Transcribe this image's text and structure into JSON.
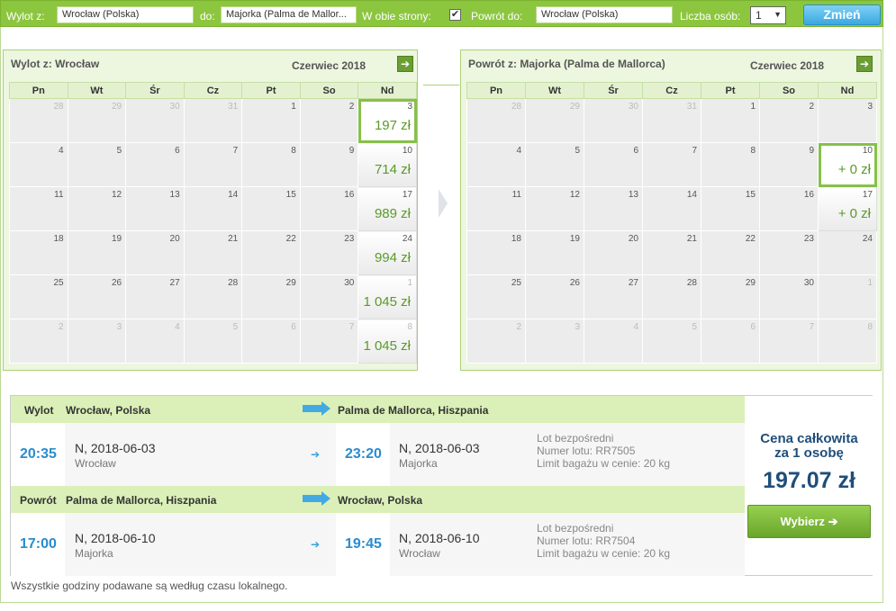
{
  "search": {
    "from_label": "Wylot z:",
    "from_value": "Wrocław (Polska)",
    "to_label": "do:",
    "to_value": "Majorka (Palma de Mallor...",
    "roundtrip_label": "W obie strony:",
    "roundtrip_check": "✔",
    "return_label": "Powrót do:",
    "return_value": "Wrocław (Polska)",
    "persons_label": "Liczba osób:",
    "persons_value": "1",
    "caret": "▼",
    "submit_label": "Zmień"
  },
  "outbound_calendar": {
    "title": "Wylot z: Wrocław",
    "month": "Czerwiec 2018",
    "next_icon": "➔",
    "weekdays": [
      "Pn",
      "Wt",
      "Śr",
      "Cz",
      "Pt",
      "So",
      "Nd"
    ],
    "weeks": [
      [
        {
          "d": "28",
          "m": true
        },
        {
          "d": "29",
          "m": true
        },
        {
          "d": "30",
          "m": true
        },
        {
          "d": "31",
          "m": true
        },
        {
          "d": "1"
        },
        {
          "d": "2"
        },
        {
          "d": "3",
          "p": "197 zł",
          "s": true
        }
      ],
      [
        {
          "d": "4"
        },
        {
          "d": "5"
        },
        {
          "d": "6"
        },
        {
          "d": "7"
        },
        {
          "d": "8"
        },
        {
          "d": "9"
        },
        {
          "d": "10",
          "p": "714 zł"
        }
      ],
      [
        {
          "d": "11"
        },
        {
          "d": "12"
        },
        {
          "d": "13"
        },
        {
          "d": "14"
        },
        {
          "d": "15"
        },
        {
          "d": "16"
        },
        {
          "d": "17",
          "p": "989 zł"
        }
      ],
      [
        {
          "d": "18"
        },
        {
          "d": "19"
        },
        {
          "d": "20"
        },
        {
          "d": "21"
        },
        {
          "d": "22"
        },
        {
          "d": "23"
        },
        {
          "d": "24",
          "p": "994 zł"
        }
      ],
      [
        {
          "d": "25"
        },
        {
          "d": "26"
        },
        {
          "d": "27"
        },
        {
          "d": "28"
        },
        {
          "d": "29"
        },
        {
          "d": "30"
        },
        {
          "d": "1",
          "m": true,
          "p": "1 045 zł"
        }
      ],
      [
        {
          "d": "2",
          "m": true
        },
        {
          "d": "3",
          "m": true
        },
        {
          "d": "4",
          "m": true
        },
        {
          "d": "5",
          "m": true
        },
        {
          "d": "6",
          "m": true
        },
        {
          "d": "7",
          "m": true
        },
        {
          "d": "8",
          "m": true,
          "p": "1 045 zł"
        }
      ]
    ]
  },
  "return_calendar": {
    "title": "Powrót z: Majorka (Palma de Mallorca)",
    "month": "Czerwiec 2018",
    "next_icon": "➔",
    "weekdays": [
      "Pn",
      "Wt",
      "Śr",
      "Cz",
      "Pt",
      "So",
      "Nd"
    ],
    "weeks": [
      [
        {
          "d": "28",
          "m": true
        },
        {
          "d": "29",
          "m": true
        },
        {
          "d": "30",
          "m": true
        },
        {
          "d": "31",
          "m": true
        },
        {
          "d": "1"
        },
        {
          "d": "2"
        },
        {
          "d": "3"
        }
      ],
      [
        {
          "d": "4"
        },
        {
          "d": "5"
        },
        {
          "d": "6"
        },
        {
          "d": "7"
        },
        {
          "d": "8"
        },
        {
          "d": "9"
        },
        {
          "d": "10",
          "p": "+ 0 zł",
          "s": true
        }
      ],
      [
        {
          "d": "11"
        },
        {
          "d": "12"
        },
        {
          "d": "13"
        },
        {
          "d": "14"
        },
        {
          "d": "15"
        },
        {
          "d": "16"
        },
        {
          "d": "17",
          "p": "+ 0 zł"
        }
      ],
      [
        {
          "d": "18"
        },
        {
          "d": "19"
        },
        {
          "d": "20"
        },
        {
          "d": "21"
        },
        {
          "d": "22"
        },
        {
          "d": "23"
        },
        {
          "d": "24"
        }
      ],
      [
        {
          "d": "25"
        },
        {
          "d": "26"
        },
        {
          "d": "27"
        },
        {
          "d": "28"
        },
        {
          "d": "29"
        },
        {
          "d": "30"
        },
        {
          "d": "1",
          "m": true
        }
      ],
      [
        {
          "d": "2",
          "m": true
        },
        {
          "d": "3",
          "m": true
        },
        {
          "d": "4",
          "m": true
        },
        {
          "d": "5",
          "m": true
        },
        {
          "d": "6",
          "m": true
        },
        {
          "d": "7",
          "m": true
        },
        {
          "d": "8",
          "m": true
        }
      ]
    ]
  },
  "outbound": {
    "label": "Wylot",
    "from": "Wrocław, Polska",
    "to": "Palma de Mallorca, Hiszpania",
    "dep_time": "20:35",
    "dep_date": "N, 2018-06-03",
    "dep_city": "Wrocław",
    "arr_time": "23:20",
    "arr_date": "N, 2018-06-03",
    "arr_city": "Majorka",
    "arrow": "➔",
    "info1": "Lot bezpośredni",
    "info2": "Numer lotu: RR7505",
    "info3": "Limit bagażu w cenie: 20 kg"
  },
  "return": {
    "label": "Powrót",
    "from": "Palma de Mallorca, Hiszpania",
    "to": "Wrocław, Polska",
    "dep_time": "17:00",
    "dep_date": "N, 2018-06-10",
    "dep_city": "Majorka",
    "arr_time": "19:45",
    "arr_date": "N, 2018-06-10",
    "arr_city": "Wrocław",
    "arrow": "➔",
    "info1": "Lot bezpośredni",
    "info2": "Numer lotu: RR7504",
    "info3": "Limit bagażu w cenie: 20 kg"
  },
  "price": {
    "caption_line1": "Cena całkowita",
    "caption_line2": "za 1 osobę",
    "amount": "197.07 zł",
    "choose_label": "Wybierz ➔"
  },
  "note": "Wszystkie godziny podawane są według czasu lokalnego."
}
